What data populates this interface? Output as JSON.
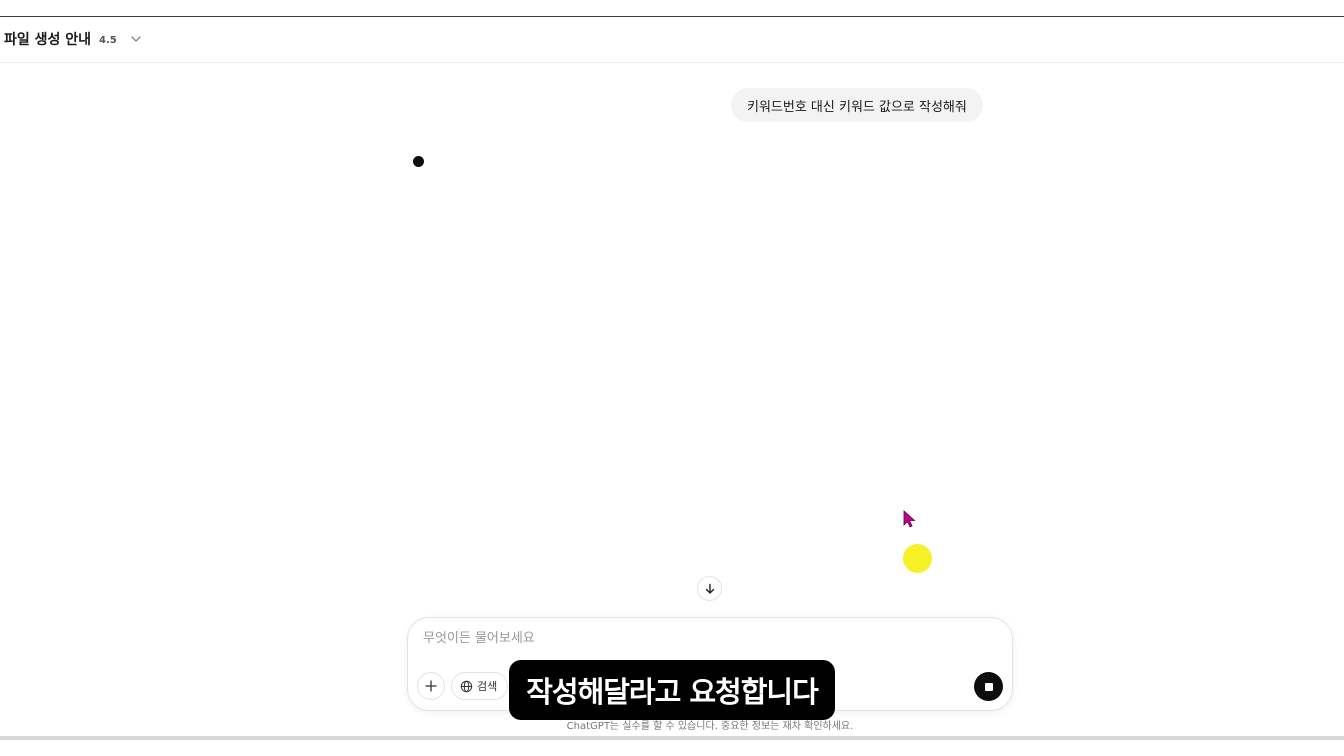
{
  "header": {
    "title": "/ 파일 생성 안내",
    "model_version": "4.5"
  },
  "conversation": {
    "user_message": "키워드번호 대신 키워드 값으로 작성해줘"
  },
  "composer": {
    "placeholder": "무엇이든 물어보세요",
    "search_label": "검색"
  },
  "footer": {
    "disclaimer": "ChatGPT는 실수를 할 수 있습니다. 중요한 정보는 재차 확인하세요."
  },
  "overlay": {
    "caption": "작성해달라고 요청합니다"
  },
  "icons": {
    "chevron": "chevron-down-icon",
    "scroll": "arrow-down-icon",
    "plus": "plus-icon",
    "globe": "globe-icon",
    "stop": "stop-icon"
  },
  "colors": {
    "cursor": "#c0008f",
    "click_highlight": "#f5f01a",
    "bubble_bg": "#f3f3f3",
    "subtitle_bg": "#000000"
  }
}
